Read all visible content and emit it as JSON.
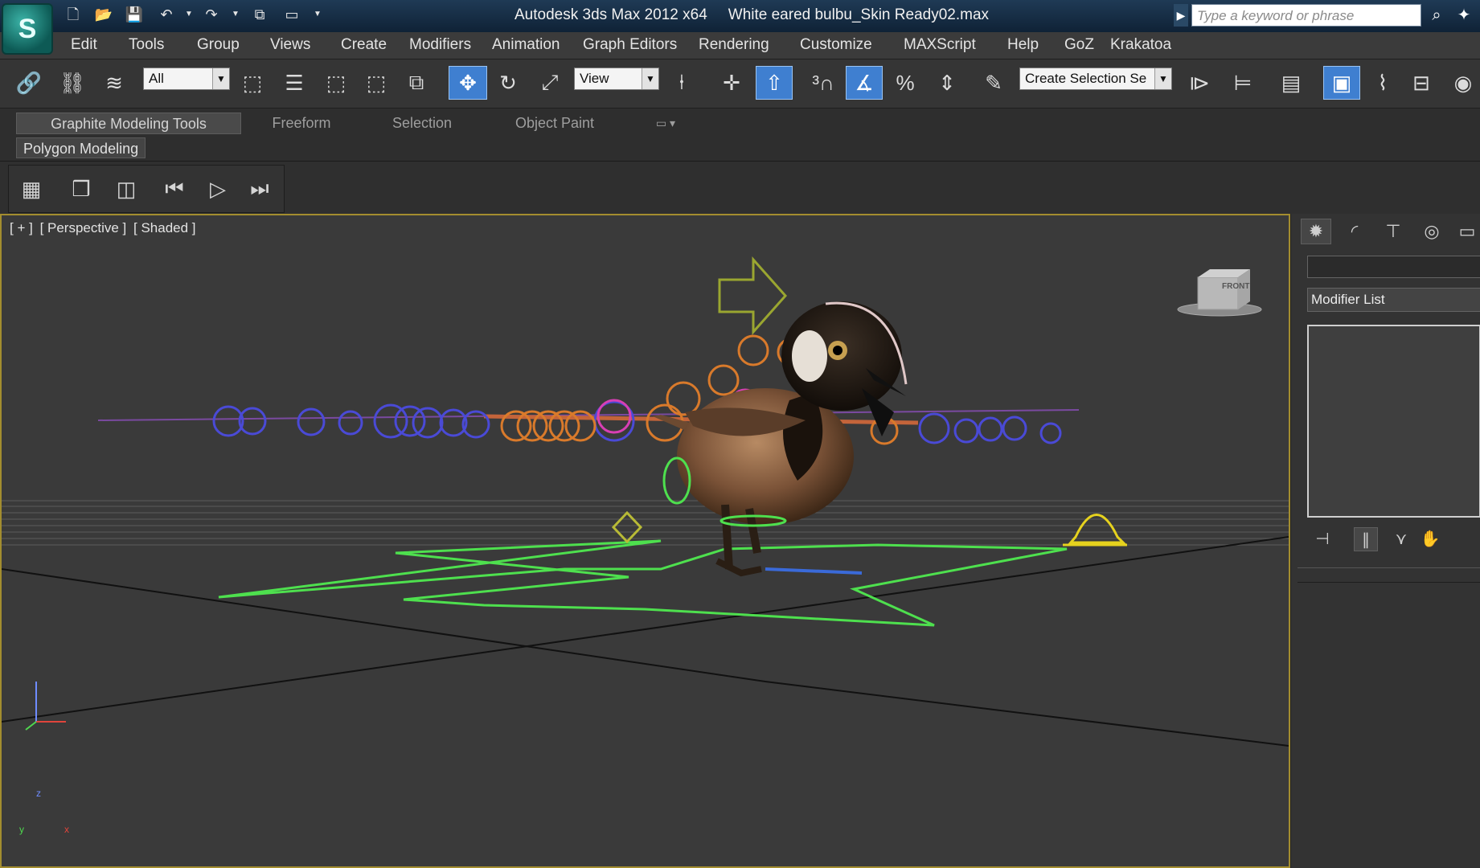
{
  "app": {
    "product": "Autodesk 3ds Max  2012 x64",
    "document": "White eared bulbu_Skin Ready02.max"
  },
  "search": {
    "placeholder": "Type a keyword or phrase"
  },
  "menu": [
    "Edit",
    "Tools",
    "Group",
    "Views",
    "Create",
    "Modifiers",
    "Animation",
    "Graph Editors",
    "Rendering",
    "Customize",
    "MAXScript",
    "Help",
    "GoZ",
    "Krakatoa"
  ],
  "toolbar": {
    "selection_filter": "All",
    "reference_coord": "View",
    "named_selection": "Create Selection Se"
  },
  "ribbon": {
    "tabs": [
      "Graphite Modeling Tools",
      "Freeform",
      "Selection",
      "Object Paint"
    ],
    "active_tab": "Graphite Modeling Tools",
    "panel": "Polygon Modeling"
  },
  "viewport": {
    "menu": "[ + ]",
    "view": "[ Perspective ]",
    "shading": "[ Shaded ]",
    "viewcube_face": "FRONT",
    "axis": {
      "x": "x",
      "y": "y",
      "z": "z"
    },
    "colors": {
      "frame": "#a38d2f",
      "spline_green": "#4ee04e",
      "bone_blue": "#4a4ad6",
      "bone_orange": "#d97a2b",
      "pink": "#d83fb4",
      "arrow_olive": "#9aa630",
      "helmet_yellow": "#e6d21e"
    }
  },
  "command_panel": {
    "modifier_list": "Modifier List"
  }
}
